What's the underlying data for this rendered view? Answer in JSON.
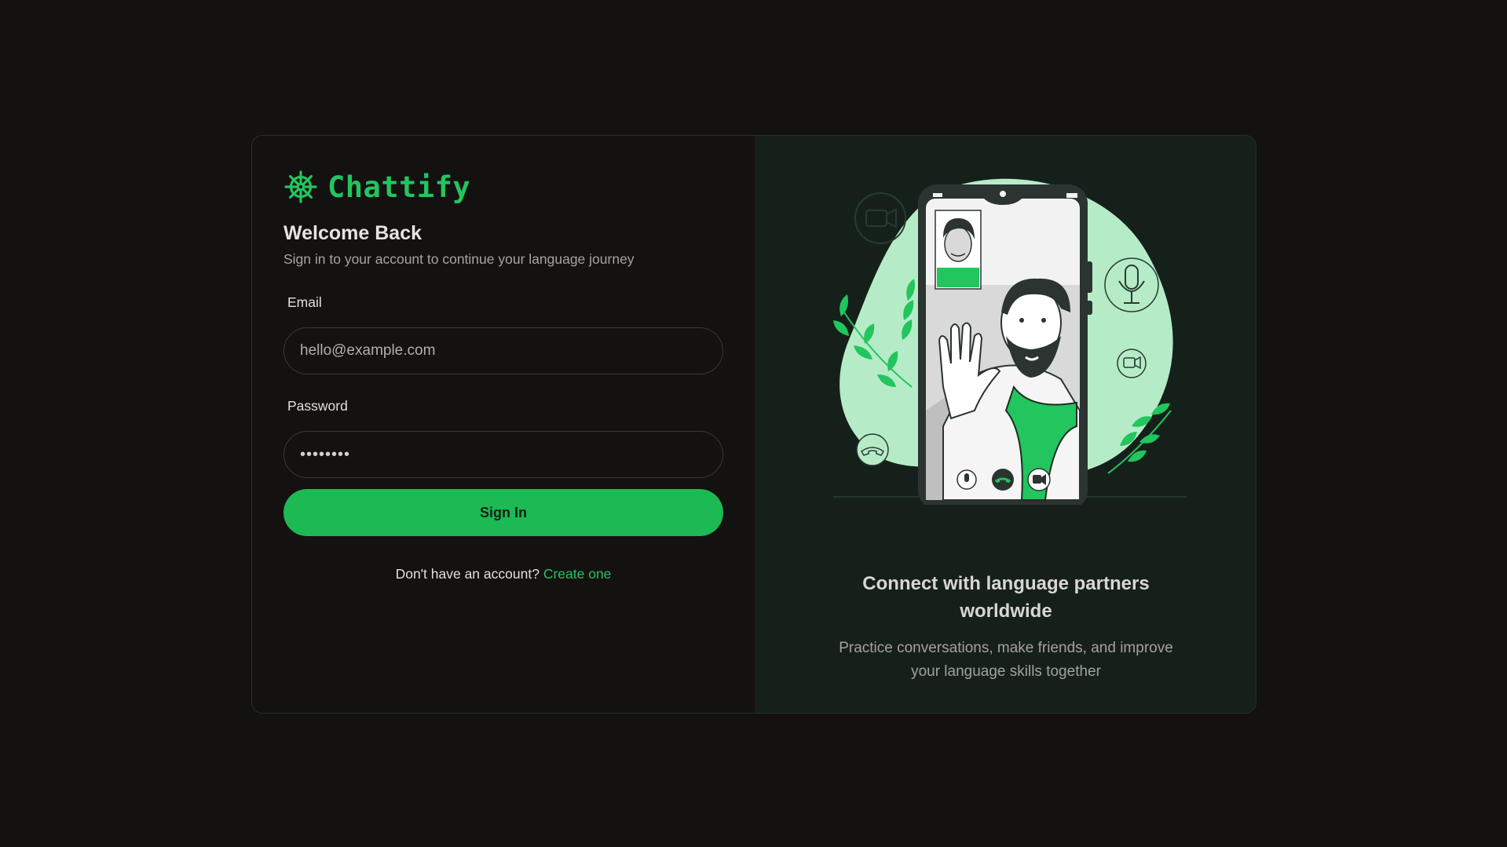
{
  "brand": {
    "name": "Chattify",
    "icon": "ship-wheel-icon",
    "color": "#22c55e"
  },
  "login": {
    "title": "Welcome Back",
    "subtitle": "Sign in to your account to continue your language journey",
    "email_label": "Email",
    "email_placeholder": "hello@example.com",
    "password_label": "Password",
    "password_value": "••••••••",
    "signin_label": "Sign In",
    "signup_prompt": "Don't have an account?",
    "signup_link": "Create one"
  },
  "promo": {
    "illustration": "video-call-illustration",
    "heading": "Connect with language partners worldwide",
    "text": "Practice conversations, make friends, and improve your language skills together"
  },
  "colors": {
    "accent": "#22c55e",
    "button": "#1db954",
    "background": "#141111",
    "panel": "#16201b"
  }
}
